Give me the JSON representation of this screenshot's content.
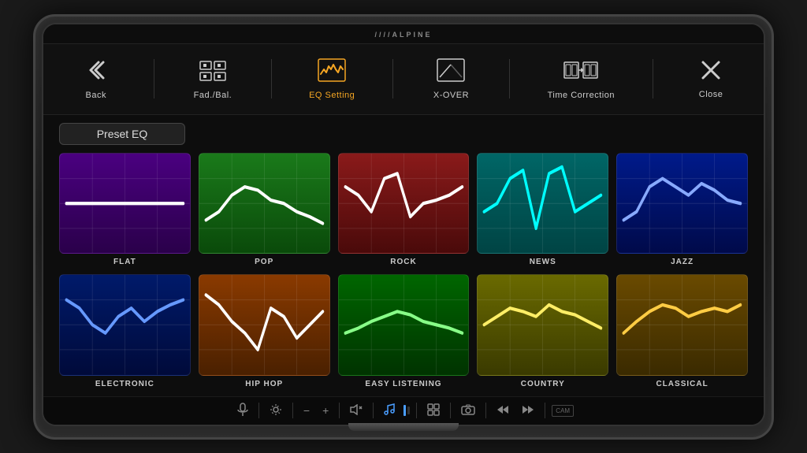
{
  "brand": "////ALPINE",
  "nav": {
    "items": [
      {
        "id": "back",
        "label": "Back",
        "icon": "back"
      },
      {
        "id": "fad-bal",
        "label": "Fad./Bal.",
        "icon": "fadbal"
      },
      {
        "id": "eq-setting",
        "label": "EQ Setting",
        "icon": "eq",
        "active": true
      },
      {
        "id": "x-over",
        "label": "X-OVER",
        "icon": "xover"
      },
      {
        "id": "time-correction",
        "label": "Time Correction",
        "icon": "timecor"
      },
      {
        "id": "close",
        "label": "Close",
        "icon": "close"
      }
    ]
  },
  "preset_label": "Preset EQ",
  "eq_presets": [
    {
      "id": "flat",
      "name": "FLAT",
      "color_class": "eq-flat",
      "curve": "flat"
    },
    {
      "id": "pop",
      "name": "POP",
      "color_class": "eq-pop",
      "curve": "pop"
    },
    {
      "id": "rock",
      "name": "ROCK",
      "color_class": "eq-rock",
      "curve": "rock"
    },
    {
      "id": "news",
      "name": "NEWS",
      "color_class": "eq-news",
      "curve": "news"
    },
    {
      "id": "jazz",
      "name": "JAZZ",
      "color_class": "eq-jazz",
      "curve": "jazz"
    },
    {
      "id": "electronic",
      "name": "ELECTRONIC",
      "color_class": "eq-electronic",
      "curve": "electronic"
    },
    {
      "id": "hiphop",
      "name": "HIP HOP",
      "color_class": "eq-hiphop",
      "curve": "hiphop"
    },
    {
      "id": "easy",
      "name": "EASY LISTENING",
      "color_class": "eq-easy",
      "curve": "easy"
    },
    {
      "id": "country",
      "name": "COUNTRY",
      "color_class": "eq-country",
      "curve": "country"
    },
    {
      "id": "classical",
      "name": "CLASSICAL",
      "color_class": "eq-classical",
      "curve": "classical"
    }
  ],
  "bottom_controls": [
    {
      "id": "mic",
      "icon": "mic",
      "active": false
    },
    {
      "id": "phone",
      "icon": "phone",
      "active": false
    },
    {
      "id": "settings-ctrl",
      "icon": "settings-small",
      "active": false
    },
    {
      "id": "minus",
      "icon": "minus",
      "active": false
    },
    {
      "id": "plus",
      "icon": "plus",
      "active": false
    },
    {
      "id": "mute",
      "icon": "mute",
      "active": false
    },
    {
      "id": "music-note",
      "icon": "music",
      "active": true
    },
    {
      "id": "volume-bar",
      "icon": "vbar",
      "active": false
    },
    {
      "id": "grid",
      "icon": "grid",
      "active": false
    },
    {
      "id": "camera",
      "icon": "camera",
      "active": false
    },
    {
      "id": "prev",
      "icon": "prev",
      "active": false
    },
    {
      "id": "next",
      "icon": "next",
      "active": false
    },
    {
      "id": "num-display",
      "icon": "num",
      "active": false
    }
  ]
}
